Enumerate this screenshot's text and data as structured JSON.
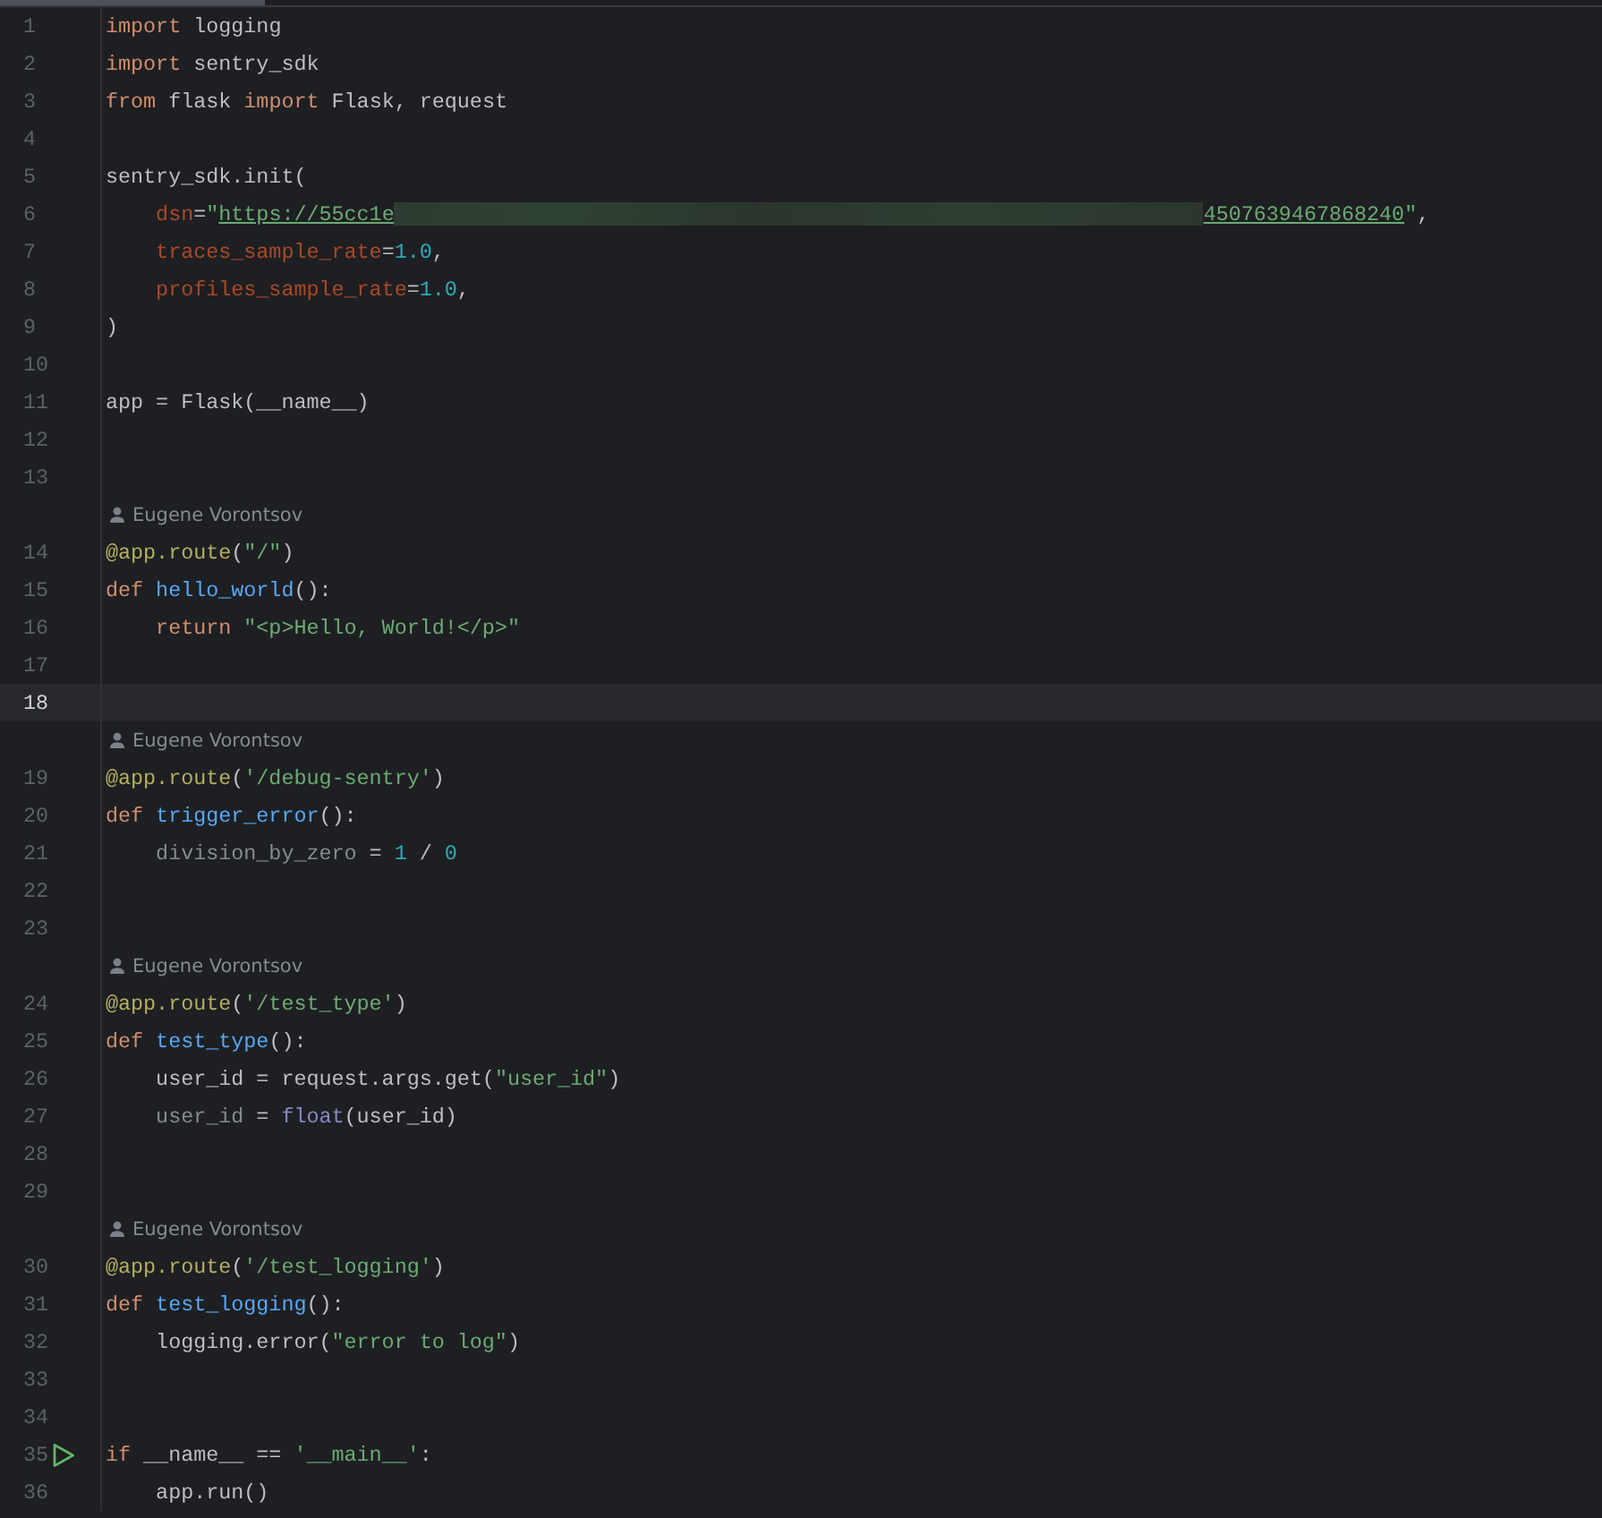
{
  "editor": {
    "rows": [
      {
        "kind": "code",
        "number": "1",
        "current": false,
        "runnable": false,
        "tokens": [
          {
            "kind": "kw",
            "text": "import"
          },
          {
            "kind": "plain",
            "text": " logging"
          }
        ]
      },
      {
        "kind": "code",
        "number": "2",
        "current": false,
        "runnable": false,
        "tokens": [
          {
            "kind": "kw",
            "text": "import"
          },
          {
            "kind": "plain",
            "text": " sentry_sdk"
          }
        ]
      },
      {
        "kind": "code",
        "number": "3",
        "current": false,
        "runnable": false,
        "tokens": [
          {
            "kind": "kw",
            "text": "from"
          },
          {
            "kind": "plain",
            "text": " flask "
          },
          {
            "kind": "kw",
            "text": "import"
          },
          {
            "kind": "plain",
            "text": " Flask, request"
          }
        ]
      },
      {
        "kind": "code",
        "number": "4",
        "current": false,
        "runnable": false,
        "tokens": []
      },
      {
        "kind": "code",
        "number": "5",
        "current": false,
        "runnable": false,
        "tokens": [
          {
            "kind": "plain",
            "text": "sentry_sdk.init("
          }
        ]
      },
      {
        "kind": "code",
        "number": "6",
        "current": false,
        "runnable": false,
        "tokens": [
          {
            "kind": "arg",
            "text": "    dsn"
          },
          {
            "kind": "plain",
            "text": "="
          },
          {
            "kind": "str",
            "text": "\""
          },
          {
            "kind": "link",
            "text": "https://55cc1e"
          },
          {
            "kind": "redacted"
          },
          {
            "kind": "link",
            "text": "4507639467868240"
          },
          {
            "kind": "str",
            "text": "\""
          },
          {
            "kind": "plain",
            "text": ","
          }
        ]
      },
      {
        "kind": "code",
        "number": "7",
        "current": false,
        "runnable": false,
        "tokens": [
          {
            "kind": "arg",
            "text": "    traces_sample_rate"
          },
          {
            "kind": "plain",
            "text": "="
          },
          {
            "kind": "num",
            "text": "1.0"
          },
          {
            "kind": "plain",
            "text": ","
          }
        ]
      },
      {
        "kind": "code",
        "number": "8",
        "current": false,
        "runnable": false,
        "tokens": [
          {
            "kind": "arg",
            "text": "    profiles_sample_rate"
          },
          {
            "kind": "plain",
            "text": "="
          },
          {
            "kind": "num",
            "text": "1.0"
          },
          {
            "kind": "plain",
            "text": ","
          }
        ]
      },
      {
        "kind": "code",
        "number": "9",
        "current": false,
        "runnable": false,
        "tokens": [
          {
            "kind": "plain",
            "text": ")"
          }
        ]
      },
      {
        "kind": "code",
        "number": "10",
        "current": false,
        "runnable": false,
        "tokens": []
      },
      {
        "kind": "code",
        "number": "11",
        "current": false,
        "runnable": false,
        "tokens": [
          {
            "kind": "plain",
            "text": "app = Flask(__name__)"
          }
        ]
      },
      {
        "kind": "code",
        "number": "12",
        "current": false,
        "runnable": false,
        "tokens": []
      },
      {
        "kind": "code",
        "number": "13",
        "current": false,
        "runnable": false,
        "tokens": []
      },
      {
        "kind": "author",
        "text": "Eugene Vorontsov"
      },
      {
        "kind": "code",
        "number": "14",
        "current": false,
        "runnable": false,
        "tokens": [
          {
            "kind": "deco",
            "text": "@app.route"
          },
          {
            "kind": "plain",
            "text": "("
          },
          {
            "kind": "str",
            "text": "\"/\""
          },
          {
            "kind": "plain",
            "text": ")"
          }
        ]
      },
      {
        "kind": "code",
        "number": "15",
        "current": false,
        "runnable": false,
        "tokens": [
          {
            "kind": "kw",
            "text": "def"
          },
          {
            "kind": "fn",
            "text": " hello_world"
          },
          {
            "kind": "plain",
            "text": "():"
          }
        ]
      },
      {
        "kind": "code",
        "number": "16",
        "current": false,
        "runnable": false,
        "tokens": [
          {
            "kind": "kw",
            "text": "    return"
          },
          {
            "kind": "str",
            "text": " \"<p>Hello, World!</p>\""
          }
        ]
      },
      {
        "kind": "code",
        "number": "17",
        "current": false,
        "runnable": false,
        "tokens": []
      },
      {
        "kind": "code",
        "number": "18",
        "current": true,
        "runnable": false,
        "tokens": []
      },
      {
        "kind": "author",
        "text": "Eugene Vorontsov"
      },
      {
        "kind": "code",
        "number": "19",
        "current": false,
        "runnable": false,
        "tokens": [
          {
            "kind": "deco",
            "text": "@app.route"
          },
          {
            "kind": "plain",
            "text": "("
          },
          {
            "kind": "str",
            "text": "'/debug-sentry'"
          },
          {
            "kind": "plain",
            "text": ")"
          }
        ]
      },
      {
        "kind": "code",
        "number": "20",
        "current": false,
        "runnable": false,
        "tokens": [
          {
            "kind": "kw",
            "text": "def"
          },
          {
            "kind": "fn",
            "text": " trigger_error"
          },
          {
            "kind": "plain",
            "text": "():"
          }
        ]
      },
      {
        "kind": "code",
        "number": "21",
        "current": false,
        "runnable": false,
        "tokens": [
          {
            "kind": "unused",
            "text": "    division_by_zero"
          },
          {
            "kind": "plain",
            "text": " = "
          },
          {
            "kind": "num",
            "text": "1"
          },
          {
            "kind": "plain",
            "text": " / "
          },
          {
            "kind": "num",
            "text": "0"
          }
        ]
      },
      {
        "kind": "code",
        "number": "22",
        "current": false,
        "runnable": false,
        "tokens": []
      },
      {
        "kind": "code",
        "number": "23",
        "current": false,
        "runnable": false,
        "tokens": []
      },
      {
        "kind": "author",
        "text": "Eugene Vorontsov"
      },
      {
        "kind": "code",
        "number": "24",
        "current": false,
        "runnable": false,
        "tokens": [
          {
            "kind": "deco",
            "text": "@app.route"
          },
          {
            "kind": "plain",
            "text": "("
          },
          {
            "kind": "str",
            "text": "'/test_type'"
          },
          {
            "kind": "plain",
            "text": ")"
          }
        ]
      },
      {
        "kind": "code",
        "number": "25",
        "current": false,
        "runnable": false,
        "tokens": [
          {
            "kind": "kw",
            "text": "def"
          },
          {
            "kind": "fn",
            "text": " test_type"
          },
          {
            "kind": "plain",
            "text": "():"
          }
        ]
      },
      {
        "kind": "code",
        "number": "26",
        "current": false,
        "runnable": false,
        "tokens": [
          {
            "kind": "plain",
            "text": "    user_id = request.args.get("
          },
          {
            "kind": "str",
            "text": "\"user_id\""
          },
          {
            "kind": "plain",
            "text": ")"
          }
        ]
      },
      {
        "kind": "code",
        "number": "27",
        "current": false,
        "runnable": false,
        "tokens": [
          {
            "kind": "unused",
            "text": "    user_id"
          },
          {
            "kind": "plain",
            "text": " = "
          },
          {
            "kind": "builtin",
            "text": "float"
          },
          {
            "kind": "plain",
            "text": "(user_id)"
          }
        ]
      },
      {
        "kind": "code",
        "number": "28",
        "current": false,
        "runnable": false,
        "tokens": []
      },
      {
        "kind": "code",
        "number": "29",
        "current": false,
        "runnable": false,
        "tokens": []
      },
      {
        "kind": "author",
        "text": "Eugene Vorontsov"
      },
      {
        "kind": "code",
        "number": "30",
        "current": false,
        "runnable": false,
        "tokens": [
          {
            "kind": "deco",
            "text": "@app.route"
          },
          {
            "kind": "plain",
            "text": "("
          },
          {
            "kind": "str",
            "text": "'/test_logging'"
          },
          {
            "kind": "plain",
            "text": ")"
          }
        ]
      },
      {
        "kind": "code",
        "number": "31",
        "current": false,
        "runnable": false,
        "tokens": [
          {
            "kind": "kw",
            "text": "def"
          },
          {
            "kind": "fn",
            "text": " test_logging"
          },
          {
            "kind": "plain",
            "text": "():"
          }
        ]
      },
      {
        "kind": "code",
        "number": "32",
        "current": false,
        "runnable": false,
        "tokens": [
          {
            "kind": "plain",
            "text": "    logging.error("
          },
          {
            "kind": "str",
            "text": "\"error to log\""
          },
          {
            "kind": "plain",
            "text": ")"
          }
        ]
      },
      {
        "kind": "code",
        "number": "33",
        "current": false,
        "runnable": false,
        "tokens": []
      },
      {
        "kind": "code",
        "number": "34",
        "current": false,
        "runnable": false,
        "tokens": []
      },
      {
        "kind": "code",
        "number": "35",
        "current": false,
        "runnable": true,
        "tokens": [
          {
            "kind": "kw",
            "text": "if"
          },
          {
            "kind": "plain",
            "text": " __name__ == "
          },
          {
            "kind": "str",
            "text": "'__main__'"
          },
          {
            "kind": "plain",
            "text": ":"
          }
        ]
      },
      {
        "kind": "code",
        "number": "36",
        "current": false,
        "runnable": false,
        "tokens": [
          {
            "kind": "plain",
            "text": "    app.run()"
          }
        ]
      }
    ]
  }
}
